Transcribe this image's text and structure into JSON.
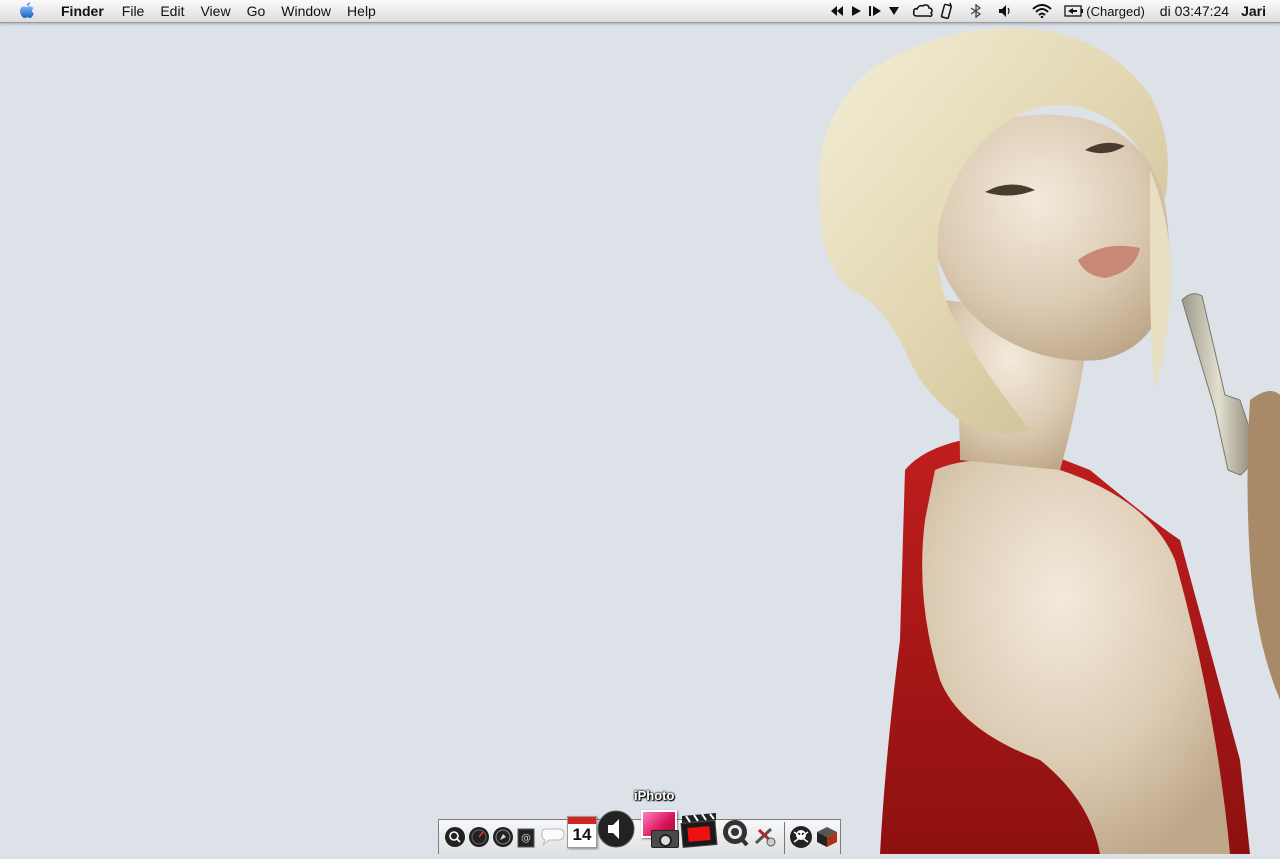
{
  "menubar": {
    "apple_icon": "apple-logo-icon",
    "app_name": "Finder",
    "menus": [
      "File",
      "Edit",
      "View",
      "Go",
      "Window",
      "Help"
    ],
    "extras": {
      "media_icons": [
        "previous-track-icon",
        "play-icon",
        "next-track-icon",
        "dropdown-triangle-icon"
      ],
      "status_icons": [
        "cloud-icon",
        "phone-icon",
        "bluetooth-icon",
        "volume-icon",
        "wifi-icon",
        "battery-icon"
      ],
      "battery_status": "(Charged)",
      "clock": "di 03:47:24",
      "user": "Jari"
    }
  },
  "desktop": {
    "background_color": "#dde1e8",
    "wallpaper": "blonde-woman-red-dress-revolver"
  },
  "dock": {
    "tooltip": "iPhoto",
    "apps": [
      {
        "name": "Spotlight",
        "icon": "spotlight-icon"
      },
      {
        "name": "Dashboard",
        "icon": "dashboard-icon"
      },
      {
        "name": "Safari",
        "icon": "safari-icon"
      },
      {
        "name": "Mail",
        "icon": "mail-icon"
      },
      {
        "name": "iChat",
        "icon": "chat-bubble-icon"
      },
      {
        "name": "iCal",
        "icon": "calendar-icon",
        "badge": "14"
      },
      {
        "name": "Volume",
        "icon": "speaker-icon"
      },
      {
        "name": "iPhoto",
        "icon": "iphoto-icon"
      },
      {
        "name": "iMovie",
        "icon": "clapperboard-icon"
      },
      {
        "name": "QuickTime",
        "icon": "quicktime-icon"
      },
      {
        "name": "Toolbox",
        "icon": "tools-icon"
      }
    ],
    "docklets": [
      {
        "name": "Trash",
        "icon": "skull-trash-icon"
      },
      {
        "name": "Box",
        "icon": "box-icon"
      }
    ]
  }
}
